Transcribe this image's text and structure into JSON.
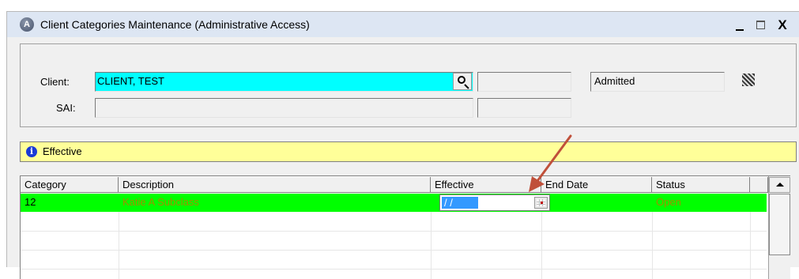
{
  "window": {
    "title": "Client Categories Maintenance (Administrative Access)",
    "app_icon_letter": "A",
    "minimize_label": "",
    "maximize_label": "",
    "close_label": "X"
  },
  "client_panel": {
    "client_label": "Client:",
    "client_value": "CLIENT, TEST",
    "sai_label": "SAI:",
    "sai_value": "",
    "client_id_value": "",
    "sai_extra_value": "",
    "status_value": "Admitted"
  },
  "info_bar": {
    "icon": "info-icon",
    "text": "Effective"
  },
  "grid": {
    "columns": [
      "Category",
      "Description",
      "Effective",
      "End Date",
      "Status"
    ],
    "rows": [
      {
        "category": "12",
        "description": "Katie A Subclass",
        "effective": "/ /",
        "end_date": "",
        "status": "Open"
      }
    ]
  },
  "colors": {
    "client_field_bg": "#00ffff",
    "info_bar_bg": "#ffff99",
    "selected_row_bg": "#00ff00",
    "row_text": "#a09000",
    "annotation_arrow": "#c0503a"
  }
}
